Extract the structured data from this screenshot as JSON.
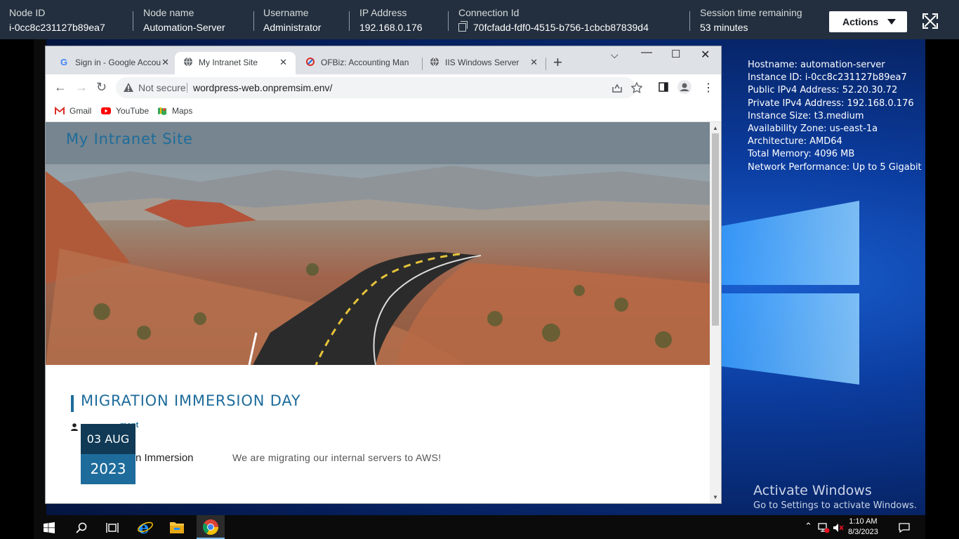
{
  "session": {
    "node_id_label": "Node ID",
    "node_id": "i-0cc8c231127b89ea7",
    "node_name_label": "Node name",
    "node_name": "Automation-Server",
    "username_label": "Username",
    "username": "Administrator",
    "ip_label": "IP Address",
    "ip": "192.168.0.176",
    "conn_label": "Connection Id",
    "conn_id": "70fcfadd-fdf0-4515-b756-1cbcb87839d4",
    "time_label": "Session time remaining",
    "time_value": "53 minutes",
    "actions_label": "Actions"
  },
  "desktop": {
    "info_lines": [
      "Hostname: automation-server",
      "Instance ID: i-0cc8c231127b89ea7",
      "Public IPv4 Address: 52.20.30.72",
      "Private IPv4 Address: 192.168.0.176",
      "Instance Size: t3.medium",
      "Availability Zone: us-east-1a",
      "Architecture: AMD64",
      "Total Memory: 4096 MB",
      "Network Performance: Up to 5 Gigabit"
    ],
    "activate_title": "Activate Windows",
    "activate_sub": "Go to Settings to activate Windows."
  },
  "browser": {
    "tabs": [
      {
        "label": "Sign in - Google Accou",
        "icon": "google-icon"
      },
      {
        "label": "My Intranet Site",
        "icon": "globe-icon"
      },
      {
        "label": "OFBiz: Accounting Man",
        "icon": "ofbiz-icon"
      },
      {
        "label": "IIS Windows Server",
        "icon": "globe-icon"
      }
    ],
    "not_secure": "Not secure",
    "url": "wordpress-web.onpremsim.env/",
    "bookmarks": [
      "Gmail",
      "YouTube",
      "Maps"
    ]
  },
  "page": {
    "site_title": "My Intranet Site",
    "post_title": "MIGRATION IMMERSION DAY",
    "author_partial": "ment",
    "date_day": "03 AUG",
    "date_year": "2023",
    "category_partial": "n Immersion",
    "body": "We are migrating our internal servers to AWS!"
  },
  "taskbar": {
    "time": "1:10 AM",
    "date": "8/3/2023"
  }
}
